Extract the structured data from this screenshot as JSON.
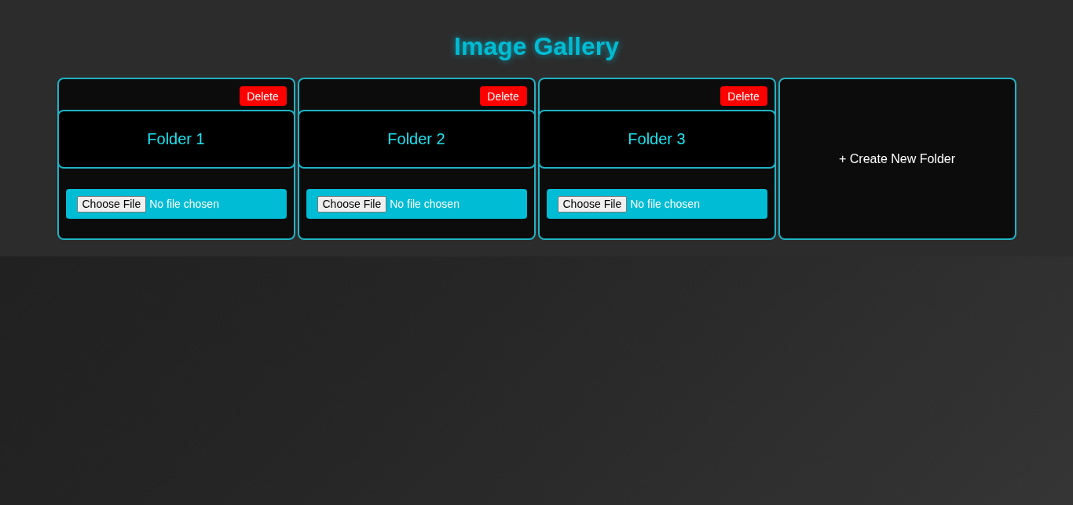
{
  "title": "Image Gallery",
  "folders": [
    {
      "name": "Folder 1",
      "delete_label": "Delete",
      "choose_label": "Choose File",
      "file_status": "No file chosen"
    },
    {
      "name": "Folder 2",
      "delete_label": "Delete",
      "choose_label": "Choose File",
      "file_status": "No file chosen"
    },
    {
      "name": "Folder 3",
      "delete_label": "Delete",
      "choose_label": "Choose File",
      "file_status": "No file chosen"
    }
  ],
  "create_folder": {
    "label": "+ Create New Folder"
  }
}
